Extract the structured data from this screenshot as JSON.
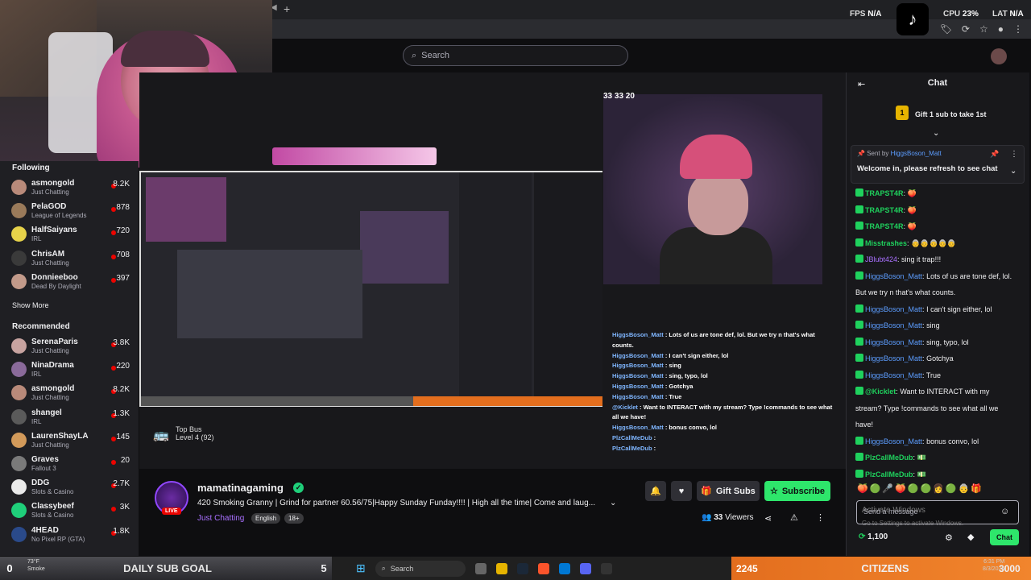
{
  "browser": {
    "perf": {
      "fps_label": "FPS",
      "fps": "N/A",
      "cpu_label": "CPU",
      "cpu": "23%",
      "lat_label": "LAT",
      "lat": "N/A"
    }
  },
  "header": {
    "search_placeholder": "Search"
  },
  "sidebar": {
    "following_title": "Following",
    "following": [
      {
        "name": "asmongold",
        "game": "Just Chatting",
        "viewers": "8.2K",
        "color": "#b98a7a"
      },
      {
        "name": "PelaGOD",
        "game": "League of Legends",
        "viewers": "878",
        "color": "#9a7a5a"
      },
      {
        "name": "HalfSaiyans",
        "game": "IRL",
        "viewers": "720",
        "color": "#e6d24a"
      },
      {
        "name": "ChrisAM",
        "game": "Just Chatting",
        "viewers": "708",
        "color": "#3a3a3a"
      },
      {
        "name": "Donnieeboo",
        "game": "Dead By Daylight",
        "viewers": "397",
        "color": "#c29a8a"
      }
    ],
    "show_more": "Show More",
    "recommended_title": "Recommended",
    "recommended": [
      {
        "name": "SerenaParis",
        "game": "Just Chatting",
        "viewers": "3.8K",
        "color": "#c7a3a0"
      },
      {
        "name": "NinaDrama",
        "game": "IRL",
        "viewers": "220",
        "color": "#8a6a9a"
      },
      {
        "name": "asmongold",
        "game": "Just Chatting",
        "viewers": "8.2K",
        "color": "#b98a7a"
      },
      {
        "name": "shangel",
        "game": "IRL",
        "viewers": "1.3K",
        "color": "#5a5a5a"
      },
      {
        "name": "LaurenShayLA",
        "game": "Just Chatting",
        "viewers": "145",
        "color": "#d29a5a"
      },
      {
        "name": "Graves",
        "game": "Fallout 3",
        "viewers": "20",
        "color": "#7a7a7a"
      },
      {
        "name": "DDG",
        "game": "Slots & Casino",
        "viewers": "2.7K",
        "color": "#eaeaea"
      },
      {
        "name": "Classybeef",
        "game": "Slots & Casino",
        "viewers": "3K",
        "color": "#1fcf7a"
      },
      {
        "name": "4HEAD",
        "game": "No Pixel RP (GTA)",
        "viewers": "1.8K",
        "color": "#2a4a8a"
      }
    ]
  },
  "video": {
    "cam_counts": "33  33  20",
    "top_bus_title": "Top Bus",
    "top_bus_level": "Level 4",
    "top_bus_count": "(92)",
    "overlay_chat": [
      {
        "user": "HiggsBoson_Matt",
        "text": "Lots of us are tone def, lol. But we try n that's what counts."
      },
      {
        "user": "HiggsBoson_Matt",
        "text": "I can't sign either, lol"
      },
      {
        "user": "HiggsBoson_Matt",
        "text": "sing"
      },
      {
        "user": "HiggsBoson_Matt",
        "text": "sing, typo, lol"
      },
      {
        "user": "HiggsBoson_Matt",
        "text": "Gotchya"
      },
      {
        "user": "HiggsBoson_Matt",
        "text": "True"
      },
      {
        "user": "@Kicklet",
        "text": "Want to INTERACT with my stream? Type !commands to see what all we have!"
      },
      {
        "user": "HiggsBoson_Matt",
        "text": "bonus convo, lol"
      },
      {
        "user": "PlzCallMeDub",
        "text": ""
      },
      {
        "user": "PlzCallMeDub",
        "text": ""
      }
    ]
  },
  "stream": {
    "channel": "mamatinagaming",
    "live": "LIVE",
    "title": "420 Smoking Granny | Grind for partner 60.56/75|Happy Sunday Funday!!!! | High all the time| Come and laug...",
    "category": "Just Chatting",
    "tags": [
      "English",
      "18+"
    ],
    "gift_label": "Gift Subs",
    "subscribe_label": "Subscribe",
    "viewers": "33",
    "viewers_label": "Viewers"
  },
  "chat": {
    "title": "Chat",
    "gift_banner": "Gift 1 sub to take 1st",
    "gift_rank": "1",
    "pinned_by_label": "Sent by",
    "pinned_by": "HiggsBoson_Matt",
    "pinned_msg": "Welcome in, please refresh to see chat",
    "messages": [
      {
        "user": "TRAPST4R",
        "text": "🍑",
        "cls": "u2"
      },
      {
        "user": "TRAPST4R",
        "text": "🍑",
        "cls": "u2"
      },
      {
        "user": "TRAPST4R",
        "text": "🍑",
        "cls": "u2"
      },
      {
        "user": "Misstrashes",
        "text": "👵👵👵👵👵",
        "cls": "u2"
      },
      {
        "user": "JBlubt424",
        "text": "sing it trap!!!",
        "cls": "u3"
      },
      {
        "user": "HiggsBoson_Matt",
        "text": "Lots of us are tone def, lol. But we try n that's what counts.",
        "cls": "u1"
      },
      {
        "user": "HiggsBoson_Matt",
        "text": "I can't sign either, lol",
        "cls": "u1"
      },
      {
        "user": "HiggsBoson_Matt",
        "text": "sing",
        "cls": "u1"
      },
      {
        "user": "HiggsBoson_Matt",
        "text": "sing, typo, lol",
        "cls": "u1"
      },
      {
        "user": "HiggsBoson_Matt",
        "text": "Gotchya",
        "cls": "u1"
      },
      {
        "user": "HiggsBoson_Matt",
        "text": "True",
        "cls": "u1"
      },
      {
        "user": "@Kicklet",
        "text": "Want to INTERACT with my stream? Type !commands to see what all we have!",
        "cls": "u2"
      },
      {
        "user": "HiggsBoson_Matt",
        "text": "bonus convo, lol",
        "cls": "u1"
      },
      {
        "user": "PlzCallMeDub",
        "text": "💵",
        "cls": "u2"
      },
      {
        "user": "PlzCallMeDub",
        "text": "💵",
        "cls": "u2"
      }
    ],
    "input_placeholder": "Send a message",
    "points": "1,100",
    "chat_button": "Chat",
    "watermark_1": "Activate Windows",
    "watermark_2": "Go to Settings to activate Windows."
  },
  "overlays": {
    "sub_goal_left": "0",
    "sub_goal_label": "DAILY SUB GOAL",
    "sub_goal_right": "5",
    "citizens_left": "2245",
    "citizens_label": "CITIZENS",
    "citizens_right": "3000",
    "weather_temp": "73°F",
    "weather_desc": "Smoke",
    "taskbar_search": "Search",
    "clock_time": "6:31 PM",
    "clock_date": "8/3/2025"
  },
  "colors": {
    "accent": "#2ee66b",
    "purple": "#a970ff",
    "live": "#eb0400",
    "citizens": "#f1852d"
  }
}
